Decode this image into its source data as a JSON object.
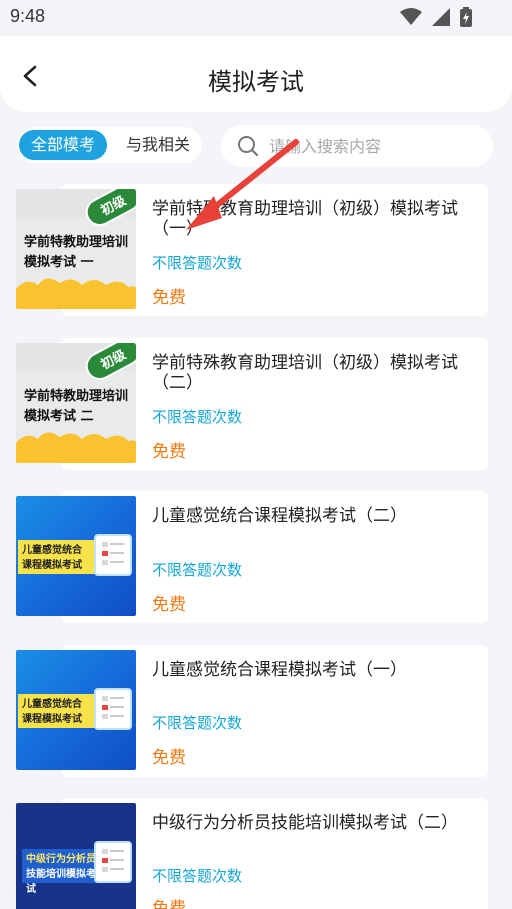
{
  "status": {
    "time": "9:48"
  },
  "nav": {
    "title": "模拟考试"
  },
  "tabs": [
    {
      "label": "全部模考",
      "active": true
    },
    {
      "label": "与我相关",
      "active": false
    }
  ],
  "search": {
    "placeholder": "请输入搜索内容",
    "value": ""
  },
  "items": [
    {
      "title": "学前特殊教育助理培训（初级）模拟考试（一）",
      "subtitle": "不限答题次数",
      "price": "免费",
      "thumb": {
        "badge": "初级",
        "line1": "学前特教助理培训",
        "line2": "模拟考试 一"
      }
    },
    {
      "title": "学前特殊教育助理培训（初级）模拟考试（二）",
      "subtitle": "不限答题次数",
      "price": "免费",
      "thumb": {
        "badge": "初级",
        "line1": "学前特教助理培训",
        "line2": "模拟考试 二"
      }
    },
    {
      "title": "儿童感觉统合课程模拟考试（二）",
      "subtitle": "不限答题次数",
      "price": "免费",
      "thumb": {
        "line1": "儿童感觉统合",
        "line2": "课程模拟考试"
      }
    },
    {
      "title": "儿童感觉统合课程模拟考试（一）",
      "subtitle": "不限答题次数",
      "price": "免费",
      "thumb": {
        "line1": "儿童感觉统合",
        "line2": "课程模拟考试"
      }
    },
    {
      "title": "中级行为分析员技能培训模拟考试（二）",
      "subtitle": "不限答题次数",
      "price": "免费",
      "thumb": {
        "line1": "中级行为分析员",
        "line2": "技能培训模拟考试"
      }
    }
  ],
  "colors": {
    "accent": "#1fa3e0",
    "subtitle": "#16a6d4",
    "price": "#f07a12",
    "arrow": "#e8413a"
  }
}
